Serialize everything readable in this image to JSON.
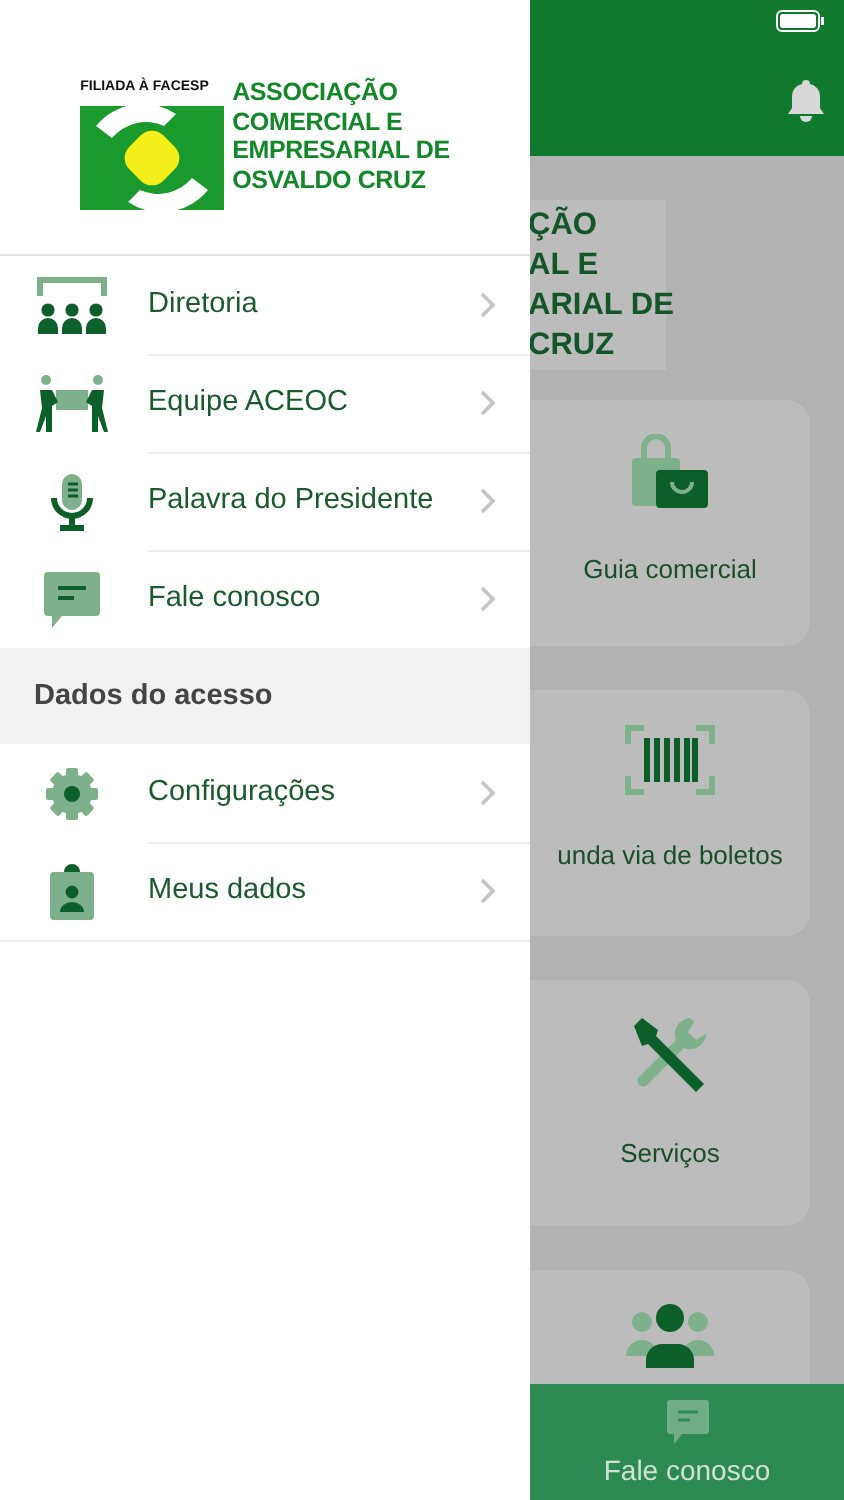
{
  "drawer": {
    "logo": {
      "tagline": "FILIADA À FACESP",
      "lines": [
        "ASSOCIAÇÃO",
        "COMERCIAL E",
        "EMPRESARIAL DE",
        "OSVALDO CRUZ"
      ]
    },
    "sections": [
      {
        "items": [
          {
            "label": "Diretoria",
            "kind": "board"
          },
          {
            "label": "Equipe ACEOC",
            "kind": "team"
          },
          {
            "label": "Palavra do Presidente",
            "kind": "mic"
          },
          {
            "label": "Fale conosco",
            "kind": "chat"
          }
        ]
      },
      {
        "title": "Dados do acesso",
        "items": [
          {
            "label": "Configurações",
            "kind": "gear"
          },
          {
            "label": "Meus dados",
            "kind": "badge"
          }
        ]
      }
    ]
  },
  "background": {
    "logo_lines": [
      "ÇÃO",
      "AL E",
      "ARIAL DE",
      "CRUZ"
    ],
    "cards": [
      {
        "label": "Guia comercial",
        "kind": "bag"
      },
      {
        "label": "unda via de boletos",
        "kind": "barcode"
      },
      {
        "label": "Serviços",
        "kind": "tools"
      },
      {
        "kind": "people"
      }
    ],
    "tab_bar": {
      "label": "Fale conosco"
    }
  }
}
